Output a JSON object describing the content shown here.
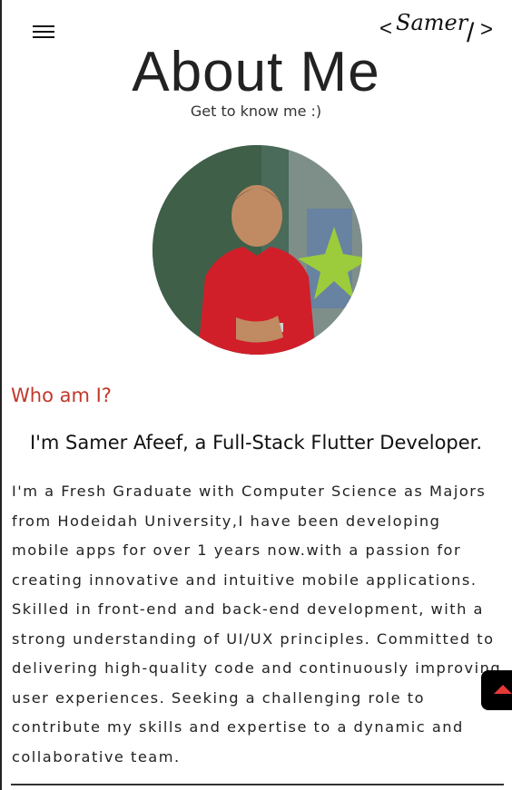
{
  "header": {
    "logo_text": "Samer",
    "logo_bracket_left": "<",
    "logo_slash": "/",
    "logo_bracket_right": ">"
  },
  "hero": {
    "title": "About Me",
    "subtitle": "Get to know me :)"
  },
  "about": {
    "heading": "Who am I?",
    "headline": "I'm Samer Afeef, a Full-Stack Flutter Developer.",
    "bio": "I'm a Fresh Graduate with Computer Science as Majors from Hodeidah University,I have been developing mobile apps for over 1 years now.with a passion for creating innovative and intuitive mobile applications. Skilled in front-end and back-end development, with a strong understanding of UI/UX principles. Committed to delivering high-quality code and continuously improving user experiences. Seeking a challenging role to contribute my skills and expertise to a dynamic and collaborative team."
  },
  "colors": {
    "accent": "#c0392b",
    "scroll_button_bg": "#000000",
    "scroll_arrow": "#e53935"
  },
  "icons": {
    "menu": "hamburger-menu-icon",
    "scroll": "arrow-up-icon"
  }
}
